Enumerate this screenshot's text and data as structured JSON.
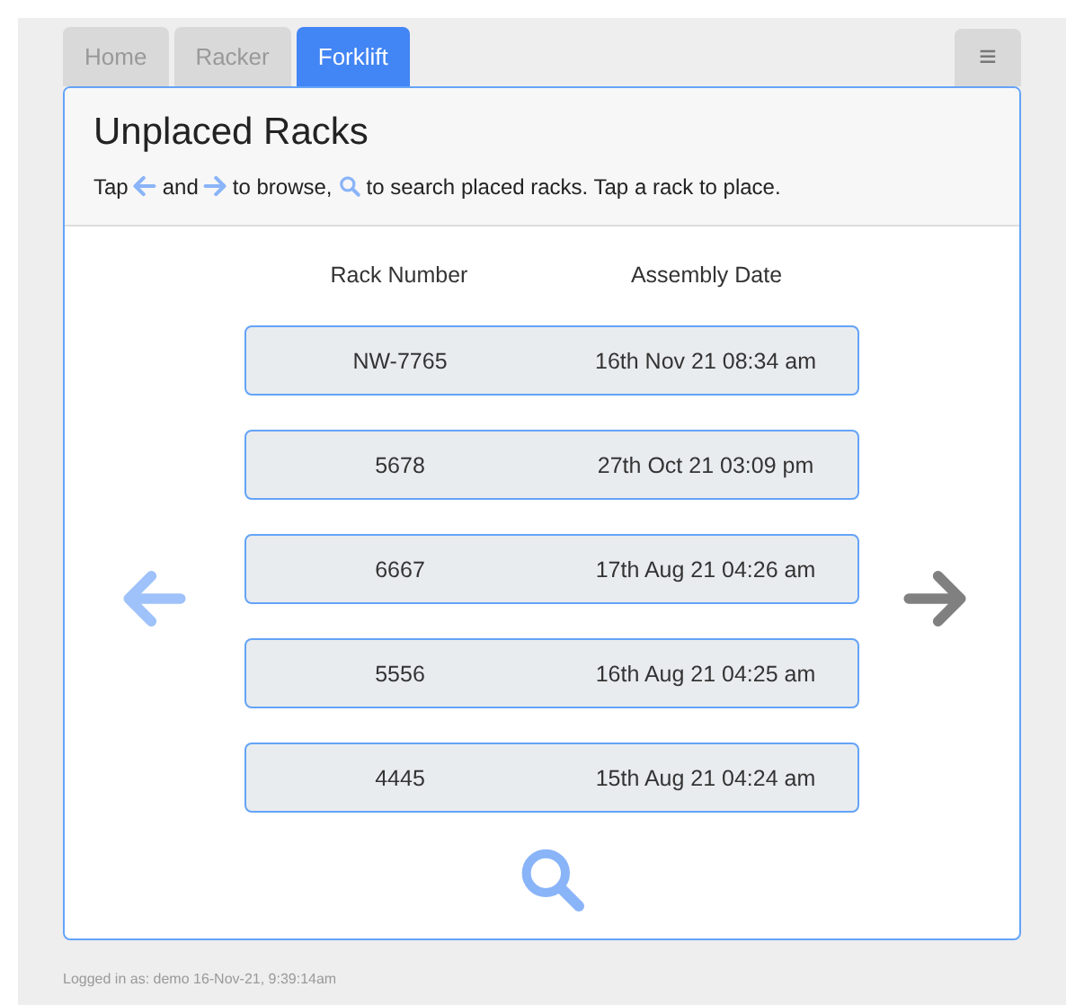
{
  "tabs": [
    {
      "label": "Home",
      "selected": false
    },
    {
      "label": "Racker",
      "selected": false
    },
    {
      "label": "Forklift",
      "selected": true
    }
  ],
  "menu_button": {
    "label": "≡"
  },
  "title": "Unplaced Racks",
  "instructions": [
    "Tap",
    "and",
    "to browse,",
    "to search placed racks. Tap a rack to place."
  ],
  "table": {
    "columns": [
      "Rack Number",
      "Assembly Date"
    ],
    "rows": [
      {
        "rack": "NW-7765",
        "date": "16th Nov 21 08:34 am"
      },
      {
        "rack": "5678",
        "date": "27th Oct 21 03:09 pm"
      },
      {
        "rack": "6667",
        "date": "17th Aug 21 04:26 am"
      },
      {
        "rack": "5556",
        "date": "16th Aug 21 04:25 am"
      },
      {
        "rack": "4445",
        "date": "15th Aug 21 04:24 am"
      }
    ]
  },
  "previous": {
    "disabled": true
  },
  "next": {
    "disabled": false
  },
  "status_bar": "Logged in as: demo 16-Nov-21, 9:39:14am"
}
